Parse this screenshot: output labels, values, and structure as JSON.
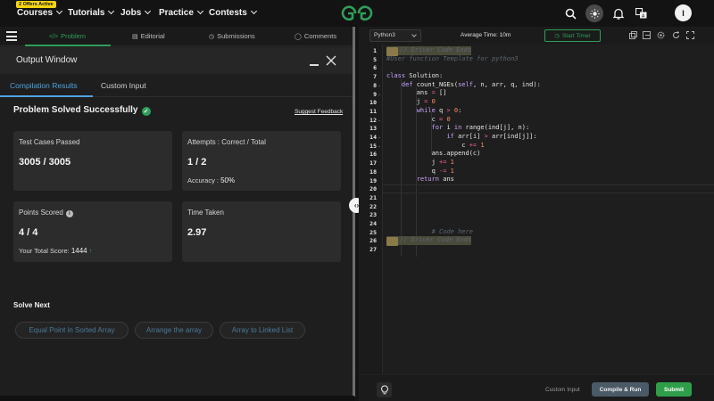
{
  "topnav": {
    "offer_badge": "2 Offers Active",
    "items": [
      "Courses",
      "Tutorials",
      "Jobs",
      "Practice",
      "Contests"
    ],
    "avatar_initial": "I"
  },
  "problem_tabs": [
    "Problem",
    "Editorial",
    "Submissions",
    "Comments"
  ],
  "output_window": {
    "title": "Output Window",
    "tabs": [
      "Compilation Results",
      "Custom Input"
    ],
    "status": "Problem Solved Successfully",
    "feedback_link": "Suggest Feedback",
    "cards": {
      "test_cases": {
        "label": "Test Cases Passed",
        "value": "3005 / 3005"
      },
      "attempts": {
        "label": "Attempts : Correct / Total",
        "value": "1 / 2",
        "accuracy_label": "Accuracy :",
        "accuracy_value": "50%"
      },
      "points": {
        "label": "Points Scored",
        "value": "4 / 4",
        "total_label": "Your Total Score:",
        "total_value": "1444"
      },
      "time": {
        "label": "Time Taken",
        "value": "2.97"
      }
    },
    "solve_next_title": "Solve Next",
    "solve_next": [
      "Equal Point in Sorted Array",
      "Arrange the array",
      "Array to Linked List"
    ]
  },
  "editor": {
    "language": "Python3",
    "average_time": "Average Time: 10m",
    "timer_label": "Start Timer",
    "line_numbers": [
      "1",
      "5",
      "6",
      "7",
      "8",
      "9",
      "10",
      "11",
      "12",
      "13",
      "14",
      "15",
      "16",
      "17",
      "18",
      "19",
      "20",
      "21",
      "22",
      "23",
      "24",
      "25",
      "26",
      "27"
    ],
    "footer": {
      "custom_input": "Custom Input",
      "compile_run": "Compile & Run",
      "submit": "Submit"
    }
  },
  "colors": {
    "accent_green": "#2f9e5a",
    "accent_blue": "#4ea3e0",
    "submit_green": "#2f9e4a"
  }
}
